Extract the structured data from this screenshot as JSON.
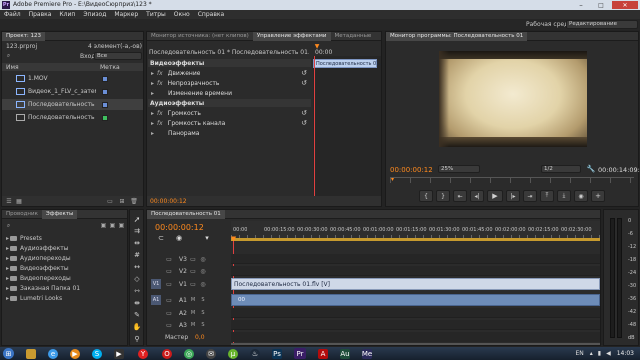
{
  "window": {
    "title": "Adobe Premiere Pro - E:\\ВидеоСюрприз\\123 *",
    "workspace_label": "Рабочая среда:",
    "workspace_value": "Редактирование"
  },
  "menu": [
    "Файл",
    "Правка",
    "Клип",
    "Эпизод",
    "Маркер",
    "Титры",
    "Окно",
    "Справка"
  ],
  "project": {
    "tab": "Проект: 123",
    "file": "123.prproj",
    "count": "4 элемент(-а,-ов)",
    "in_label": "Вход:",
    "in_value": "Все",
    "col_name": "Имя",
    "col_label": "Метка",
    "items": [
      {
        "name": "1.MOV",
        "color": "#6b8fd6"
      },
      {
        "name": "Видеок_1_FLV_с_затем",
        "color": "#6b8fd6"
      },
      {
        "name": "Последовательность 01.fl",
        "color": "#6b8fd6"
      },
      {
        "name": "Последовательность 01",
        "color": "#3fbf5f"
      }
    ]
  },
  "source_tabs": [
    "Монитор источника: (нет клипов)",
    "Управление эффектами",
    "Метаданные"
  ],
  "effects_ctrl": {
    "header": "Последовательность 01 * Последовательность 01.flv",
    "clip_label": "Последовательность 01.",
    "time_start": "00:00",
    "video_label": "Видеоэффекты",
    "video_items": [
      "Движение",
      "Непрозрачность",
      "Изменение времени"
    ],
    "audio_label": "Аудиоэффекты",
    "audio_items": [
      "Громкость",
      "Громкость канала",
      "Панорама"
    ],
    "timecode": "00:00:00:12"
  },
  "program": {
    "tab": "Монитор программы: Последовательность 01",
    "timecode": "00:00:00:12",
    "zoom": "25%",
    "quality": "1/2",
    "duration": "00:00:14:09:01"
  },
  "effects_panel": {
    "tabs": [
      "Проводник",
      "Эффекты"
    ],
    "items": [
      "Presets",
      "Аудиоэффекты",
      "Аудиопереходы",
      "Видеоэффекты",
      "Видеопереходы",
      "Заказная Папка 01",
      "Lumetri Looks"
    ]
  },
  "timeline": {
    "tab": "Последовательность 01",
    "timecode": "00:00:00:12",
    "ruler": [
      "00:00",
      "00:00:15:00",
      "00:00:30:00",
      "00:00:45:00",
      "00:01:00:00",
      "00:01:15:00",
      "00:01:30:00",
      "00:01:45:00",
      "00:02:00:00",
      "00:02:15:00",
      "00:02:30:00"
    ],
    "video_tracks": [
      "V3",
      "V2",
      "V1"
    ],
    "audio_tracks": [
      "A1",
      "A2",
      "A3"
    ],
    "master_label": "Мастер",
    "master_value": "0,0",
    "video_clip": "Последовательность 01.flv [V]",
    "audio_clip": "00"
  },
  "meter": {
    "labels": [
      "0",
      "-6",
      "-12",
      "-18",
      "-24",
      "-30",
      "-36",
      "-42",
      "-48",
      "dB"
    ]
  },
  "taskbar": {
    "lang": "EN",
    "time": "14:03"
  }
}
